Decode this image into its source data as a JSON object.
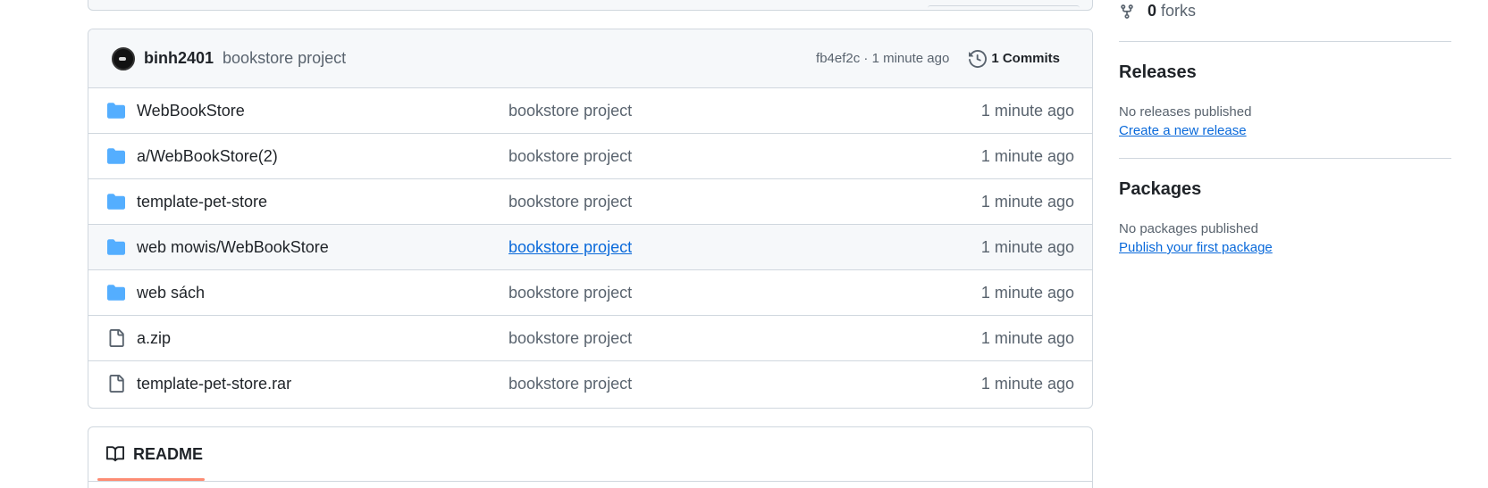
{
  "commit": {
    "author": "binh2401",
    "message": "bookstore project",
    "meta": "fb4ef2c · 1 minute ago",
    "commits_label": "1 Commits"
  },
  "files": [
    {
      "name": "WebBookStore",
      "type": "folder",
      "message": "bookstore project",
      "age": "1 minute ago"
    },
    {
      "name": "a/WebBookStore(2)",
      "type": "folder",
      "message": "bookstore project",
      "age": "1 minute ago"
    },
    {
      "name": "template-pet-store",
      "type": "folder",
      "message": "bookstore project",
      "age": "1 minute ago"
    },
    {
      "name": "web mowis/WebBookStore",
      "type": "folder",
      "message": "bookstore project",
      "age": "1 minute ago"
    },
    {
      "name": "web sách",
      "type": "folder",
      "message": "bookstore project",
      "age": "1 minute ago"
    },
    {
      "name": "a.zip",
      "type": "file",
      "message": "bookstore project",
      "age": "1 minute ago"
    },
    {
      "name": "template-pet-store.rar",
      "type": "file",
      "message": "bookstore project",
      "age": "1 minute ago"
    }
  ],
  "readme": {
    "label": "README"
  },
  "sidebar": {
    "forks_count": "0",
    "forks_label": "forks",
    "releases": {
      "title": "Releases",
      "note": "No releases published",
      "link": "Create a new release"
    },
    "packages": {
      "title": "Packages",
      "note": "No packages published",
      "link": "Publish your first package"
    }
  },
  "colors": {
    "accent": "#0969da",
    "folder": "#54aeff",
    "tab_underline": "#fd8c73"
  },
  "icons": {
    "folder": "folder-icon",
    "file": "file-icon",
    "history": "history-icon",
    "fork": "fork-icon",
    "book": "book-icon"
  }
}
